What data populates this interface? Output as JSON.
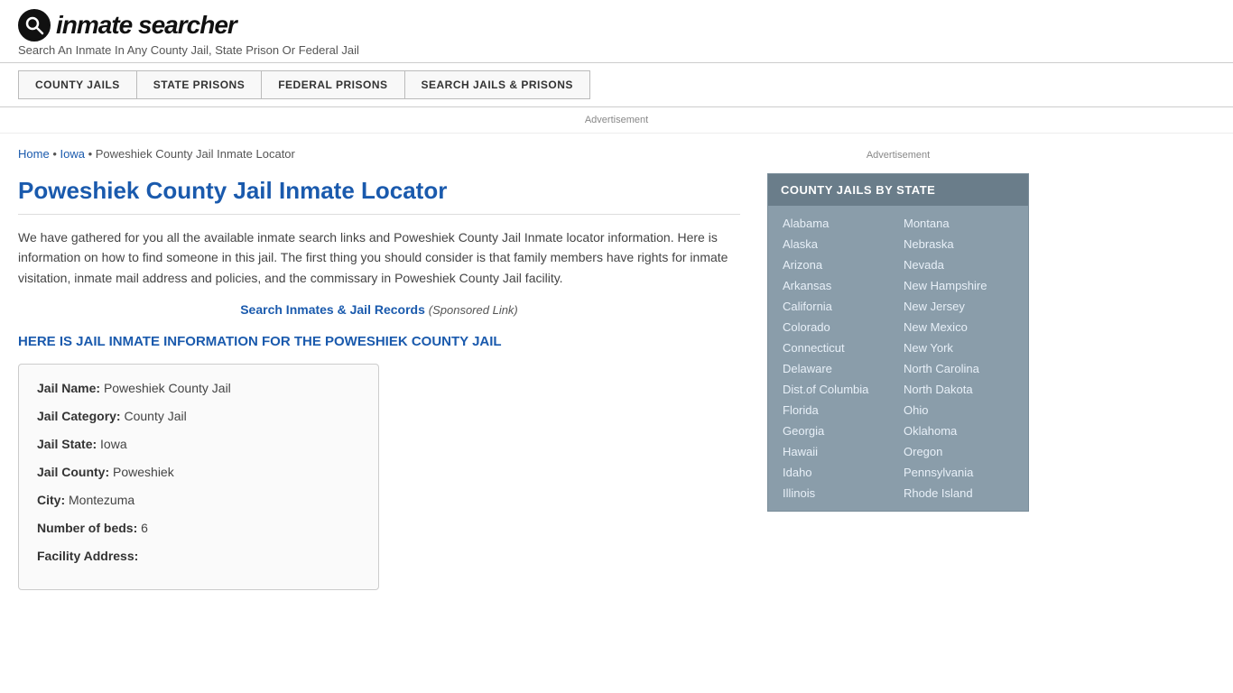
{
  "header": {
    "logo_icon": "Q",
    "logo_text": "inmate searcher",
    "tagline": "Search An Inmate In Any County Jail, State Prison Or Federal Jail"
  },
  "nav": {
    "items": [
      {
        "label": "COUNTY JAILS",
        "id": "county-jails"
      },
      {
        "label": "STATE PRISONS",
        "id": "state-prisons"
      },
      {
        "label": "FEDERAL PRISONS",
        "id": "federal-prisons"
      },
      {
        "label": "SEARCH JAILS & PRISONS",
        "id": "search-jails"
      }
    ]
  },
  "ad_label": "Advertisement",
  "breadcrumb": {
    "home": "Home",
    "state": "Iowa",
    "current": "Poweshiek County Jail Inmate Locator"
  },
  "page_title": "Poweshiek County Jail Inmate Locator",
  "description": "We have gathered for you all the available inmate search links and Poweshiek County Jail Inmate locator information. Here is information on how to find someone in this jail. The first thing you should consider is that family members have rights for inmate visitation, inmate mail address and policies, and the commissary in Poweshiek County Jail facility.",
  "search_link": {
    "text": "Search Inmates & Jail Records",
    "sponsored": "(Sponsored Link)"
  },
  "section_heading": "HERE IS JAIL INMATE INFORMATION FOR THE POWESHIEK COUNTY JAIL",
  "info_box": {
    "jail_name_label": "Jail Name:",
    "jail_name_value": "Poweshiek County Jail",
    "jail_category_label": "Jail Category:",
    "jail_category_value": "County Jail",
    "jail_state_label": "Jail State:",
    "jail_state_value": "Iowa",
    "jail_county_label": "Jail County:",
    "jail_county_value": "Poweshiek",
    "city_label": "City:",
    "city_value": "Montezuma",
    "beds_label": "Number of beds:",
    "beds_value": "6",
    "address_label": "Facility Address:"
  },
  "sidebar": {
    "ad_label": "Advertisement",
    "county_jails_title": "COUNTY JAILS BY STATE",
    "states_col1": [
      "Alabama",
      "Alaska",
      "Arizona",
      "Arkansas",
      "California",
      "Colorado",
      "Connecticut",
      "Delaware",
      "Dist.of Columbia",
      "Florida",
      "Georgia",
      "Hawaii",
      "Idaho",
      "Illinois"
    ],
    "states_col2": [
      "Montana",
      "Nebraska",
      "Nevada",
      "New Hampshire",
      "New Jersey",
      "New Mexico",
      "New York",
      "North Carolina",
      "North Dakota",
      "Ohio",
      "Oklahoma",
      "Oregon",
      "Pennsylvania",
      "Rhode Island"
    ]
  }
}
